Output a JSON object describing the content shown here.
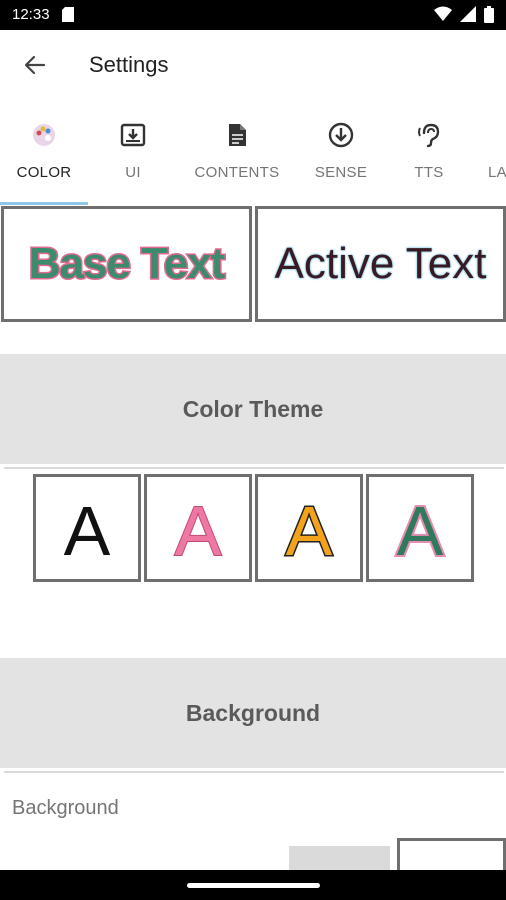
{
  "status_bar": {
    "time": "12:33"
  },
  "app_bar": {
    "title": "Settings"
  },
  "tabs": [
    {
      "label": "COLOR",
      "icon": "palette-icon",
      "active": true
    },
    {
      "label": "UI",
      "icon": "download-box-icon",
      "active": false
    },
    {
      "label": "CONTENTS",
      "icon": "document-icon",
      "active": false
    },
    {
      "label": "SENSE",
      "icon": "arrow-circle-down-icon",
      "active": false
    },
    {
      "label": "TTS",
      "icon": "ear-icon",
      "active": false
    },
    {
      "label": "LA",
      "icon": "",
      "active": false
    }
  ],
  "preview": {
    "base_text": "Base Text",
    "active_text": "Active Text"
  },
  "color_theme": {
    "header": "Color Theme",
    "swatches": [
      {
        "letter": "A",
        "color": "#111111"
      },
      {
        "letter": "A",
        "color": "#ee77a3"
      },
      {
        "letter": "A",
        "color": "#f3a21c"
      },
      {
        "letter": "A",
        "color": "#2f7a5c"
      }
    ]
  },
  "background": {
    "header": "Background",
    "label": "Background"
  },
  "colors": {
    "accent_indicator": "#90c6e8",
    "section_bg": "#e3e3e3",
    "base_text_fill": "#3d8b6d",
    "base_text_outline": "#e06a92"
  }
}
